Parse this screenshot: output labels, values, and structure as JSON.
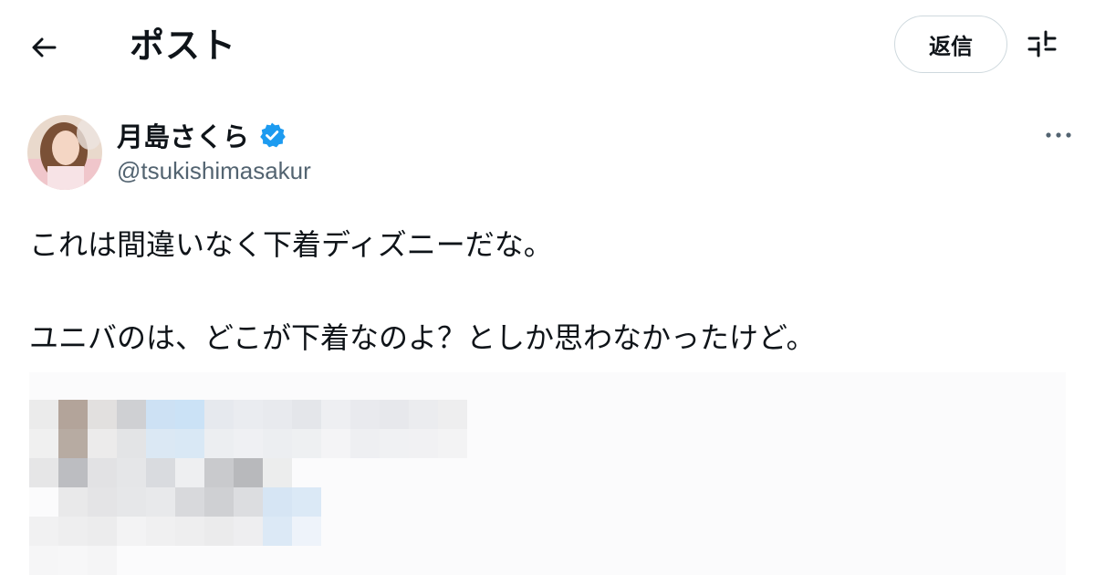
{
  "header": {
    "title": "ポスト",
    "reply_label": "返信",
    "back_icon": "arrow-left-icon",
    "settings_icon": "sliders-icon"
  },
  "author": {
    "display_name": "月島さくら",
    "handle": "@tsukishimasakur",
    "verified": true,
    "verified_color": "#1d9bf0"
  },
  "tweet": {
    "line1": "これは間違いなく下着ディズニーだな。",
    "line2": "ユニバのは、どこが下着なのよ？としか思わなかったけど。"
  },
  "media": {
    "state": "pixelated"
  }
}
